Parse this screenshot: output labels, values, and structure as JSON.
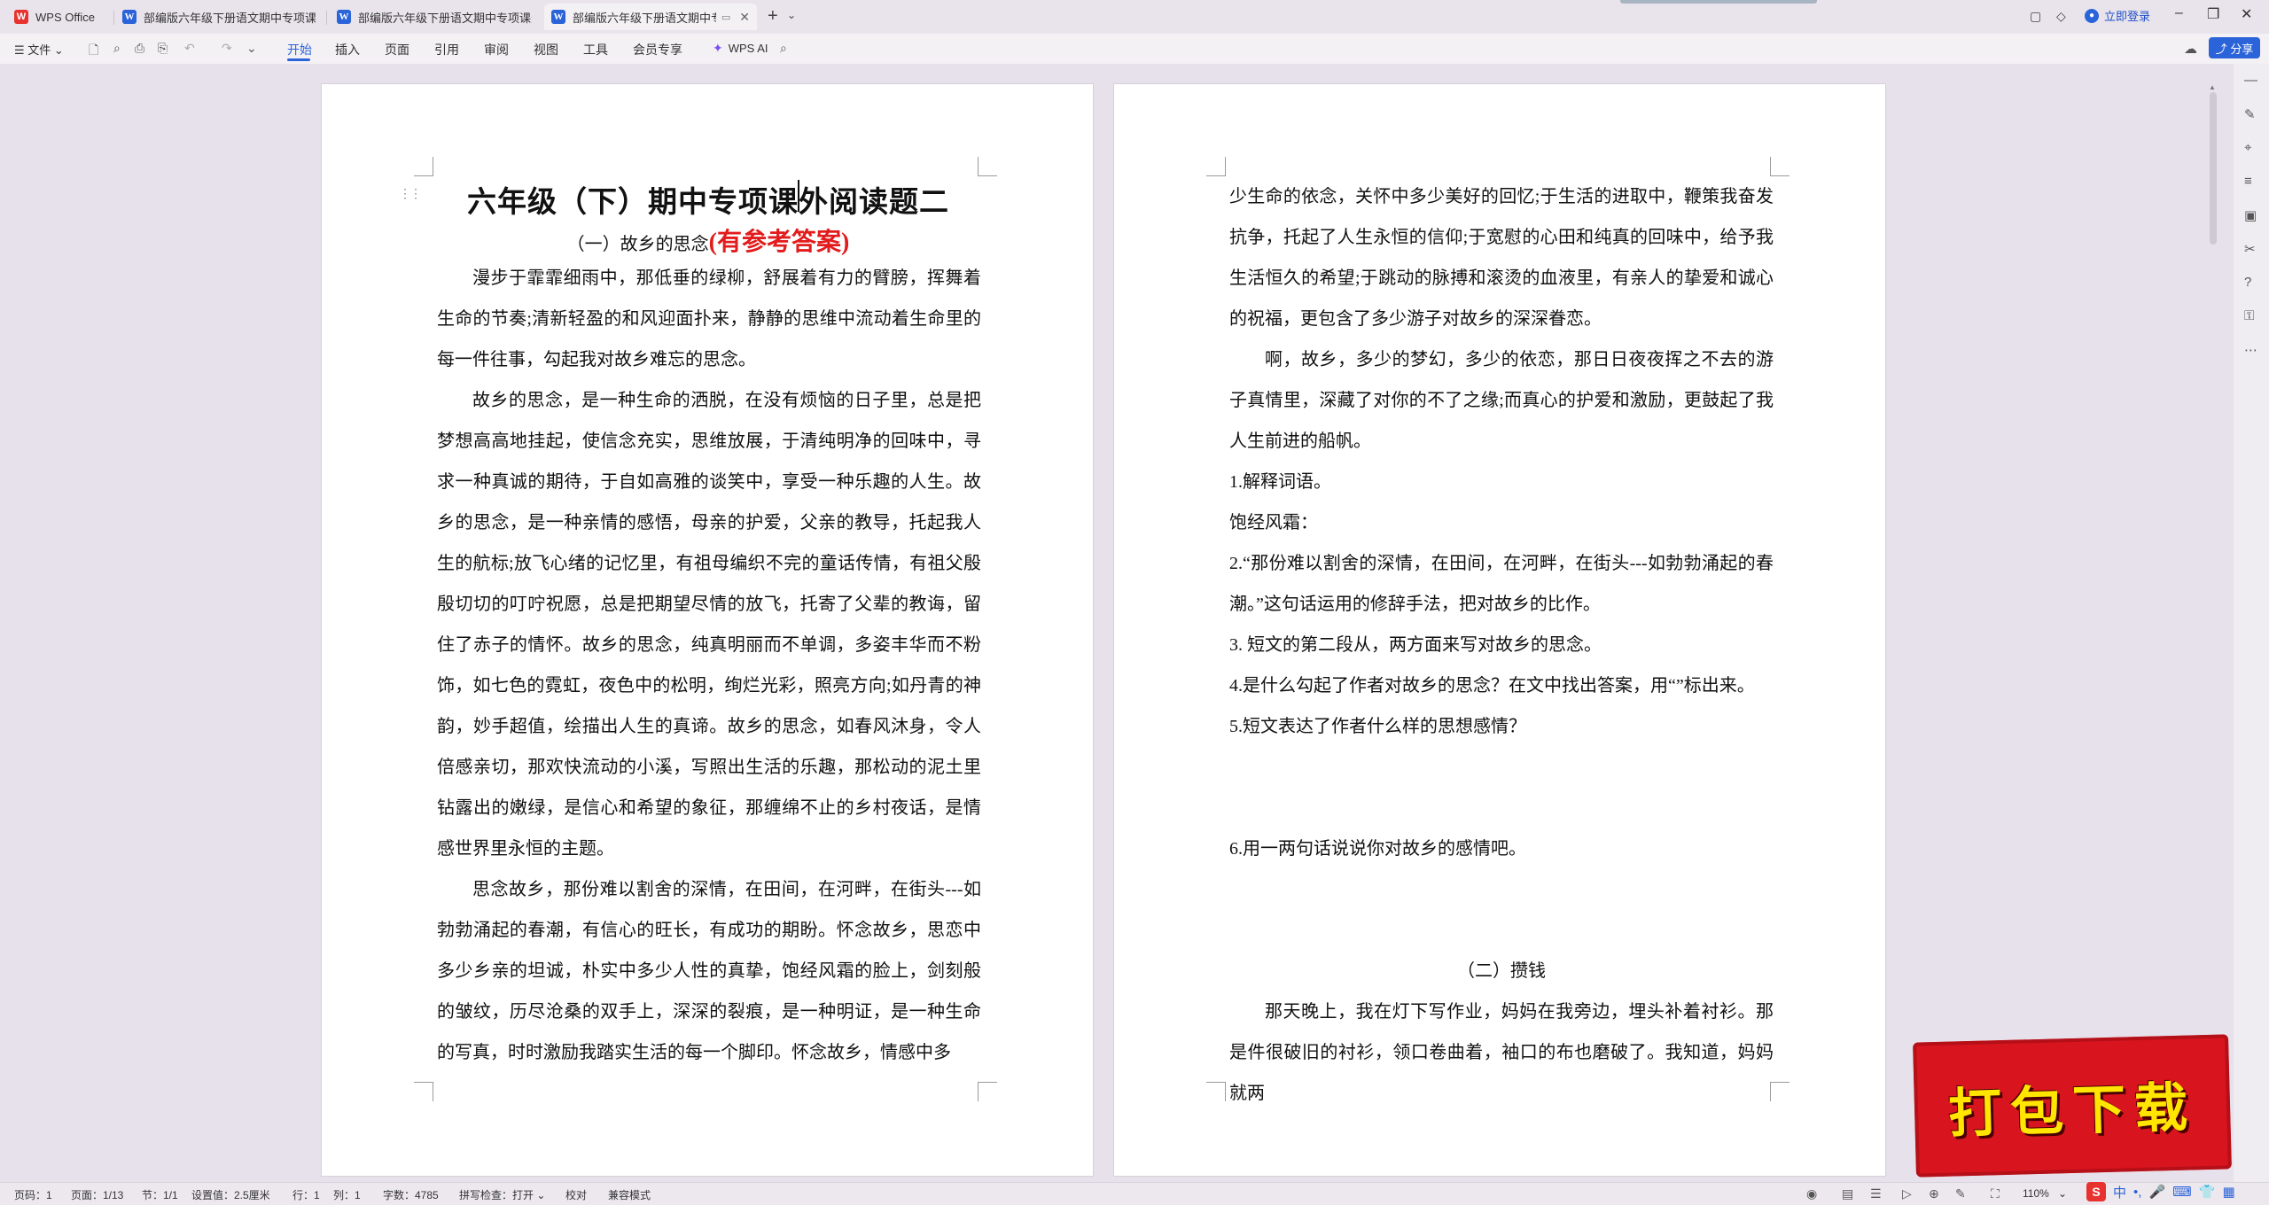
{
  "tabs": [
    {
      "label": "WPS Office",
      "icon": "wps-logo-icon",
      "active": false
    },
    {
      "label": "部编版六年级下册语文期中专项课外",
      "icon": "doc-icon",
      "active": false
    },
    {
      "label": "部编版六年级下册语文期中专项课外",
      "icon": "doc-icon",
      "active": false
    },
    {
      "label": "部编版六年级下册语文期中专",
      "icon": "doc-icon",
      "active": true
    }
  ],
  "header": {
    "login_label": "立即登录"
  },
  "ribbon": {
    "file_label": "文件",
    "menu": [
      "开始",
      "插入",
      "页面",
      "引用",
      "审阅",
      "视图",
      "工具",
      "会员专享"
    ],
    "active_menu": "开始",
    "wps_ai_label": "WPS AI",
    "share_label": "分享"
  },
  "document": {
    "title": "六年级（下）期中专项课外阅读题二",
    "section1_title": "（一）故乡的思念",
    "answer_tag": "(有参考答案)",
    "page1_paragraphs": [
      "漫步于霏霏细雨中，那低垂的绿柳，舒展着有力的臂膀，挥舞着生命的节奏;清新轻盈的和风迎面扑来，静静的思维中流动着生命里的每一件往事，勾起我对故乡难忘的思念。",
      "故乡的思念，是一种生命的洒脱，在没有烦恼的日子里，总是把梦想高高地挂起，使信念充实，思维放展，于清纯明净的回味中，寻求一种真诚的期待，于自如高雅的谈笑中，享受一种乐趣的人生。故乡的思念，是一种亲情的感悟，母亲的护爱，父亲的教导，托起我人生的航标;放飞心绪的记忆里，有祖母编织不完的童话传情，有祖父殷殷切切的叮咛祝愿，总是把期望尽情的放飞，托寄了父辈的教诲，留住了赤子的情怀。故乡的思念，纯真明丽而不单调，多姿丰华而不粉饰，如七色的霓虹，夜色中的松明，绚烂光彩，照亮方向;如丹青的神韵，妙手超值，绘描出人生的真谛。故乡的思念，如春风沐身，令人倍感亲切，那欢快流动的小溪，写照出生活的乐趣，那松动的泥土里钻露出的嫩绿，是信心和希望的象征，那缠绵不止的乡村夜话，是情感世界里永恒的主题。",
      "思念故乡，那份难以割舍的深情，在田间，在河畔，在街头---如勃勃涌起的春潮，有信心的旺长，有成功的期盼。怀念故乡，思恋中多少乡亲的坦诚，朴实中多少人性的真挚，饱经风霜的脸上，剑刻般的皱纹，历尽沧桑的双手上，深深的裂痕，是一种明证，是一种生命的写真，时时激励我踏实生活的每一个脚印。怀念故乡，情感中多"
    ],
    "page2_paragraphs": [
      "少生命的依念，关怀中多少美好的回忆;于生活的进取中，鞭策我奋发抗争，托起了人生永恒的信仰;于宽慰的心田和纯真的回味中，给予我生活恒久的希望;于跳动的脉搏和滚烫的血液里，有亲人的挚爱和诚心的祝福，更包含了多少游子对故乡的深深眷恋。",
      "啊，故乡，多少的梦幻，多少的依恋，那日日夜夜挥之不去的游子真情里，深藏了对你的不了之缘;而真心的护爱和激励，更鼓起了我人生前进的船帆。"
    ],
    "questions": [
      "1.解释词语。",
      "饱经风霜：",
      "2.“那份难以割舍的深情，在田间，在河畔，在街头---如勃勃涌起的春潮。”这句话运用的修辞手法，把对故乡的比作。",
      "3.  短文的第二段从，两方面来写对故乡的思念。",
      "4.是什么勾起了作者对故乡的思念？在文中找出答案，用“”标出来。",
      "5.短文表达了作者什么样的思想感情？",
      "6.用一两句话说说你对故乡的感情吧。"
    ],
    "section2_title": "（二）攒钱",
    "section2_paragraph": "那天晚上，我在灯下写作业，妈妈在我旁边，埋头补着衬衫。那是件很破旧的衬衫，领口卷曲着，袖口的布也磨破了。我知道，妈妈就两"
  },
  "statusbar": {
    "page_number": "页码：1",
    "page_count": "页面：1/13",
    "section": "节：1/1",
    "setting": "设置值：2.5厘米",
    "row": "行：1",
    "col": "列：1",
    "word_count": "字数：4785",
    "spellcheck": "拼写检查：打开",
    "proofread": "校对",
    "compat": "兼容模式",
    "zoom": "110%"
  },
  "ime": {
    "label": "中"
  },
  "banner": {
    "text": "打包下载"
  },
  "colors": {
    "accent": "#2b63d9",
    "answer_red": "#e21c1c",
    "banner_red": "#d8141f",
    "banner_yellow": "#ffe500"
  }
}
